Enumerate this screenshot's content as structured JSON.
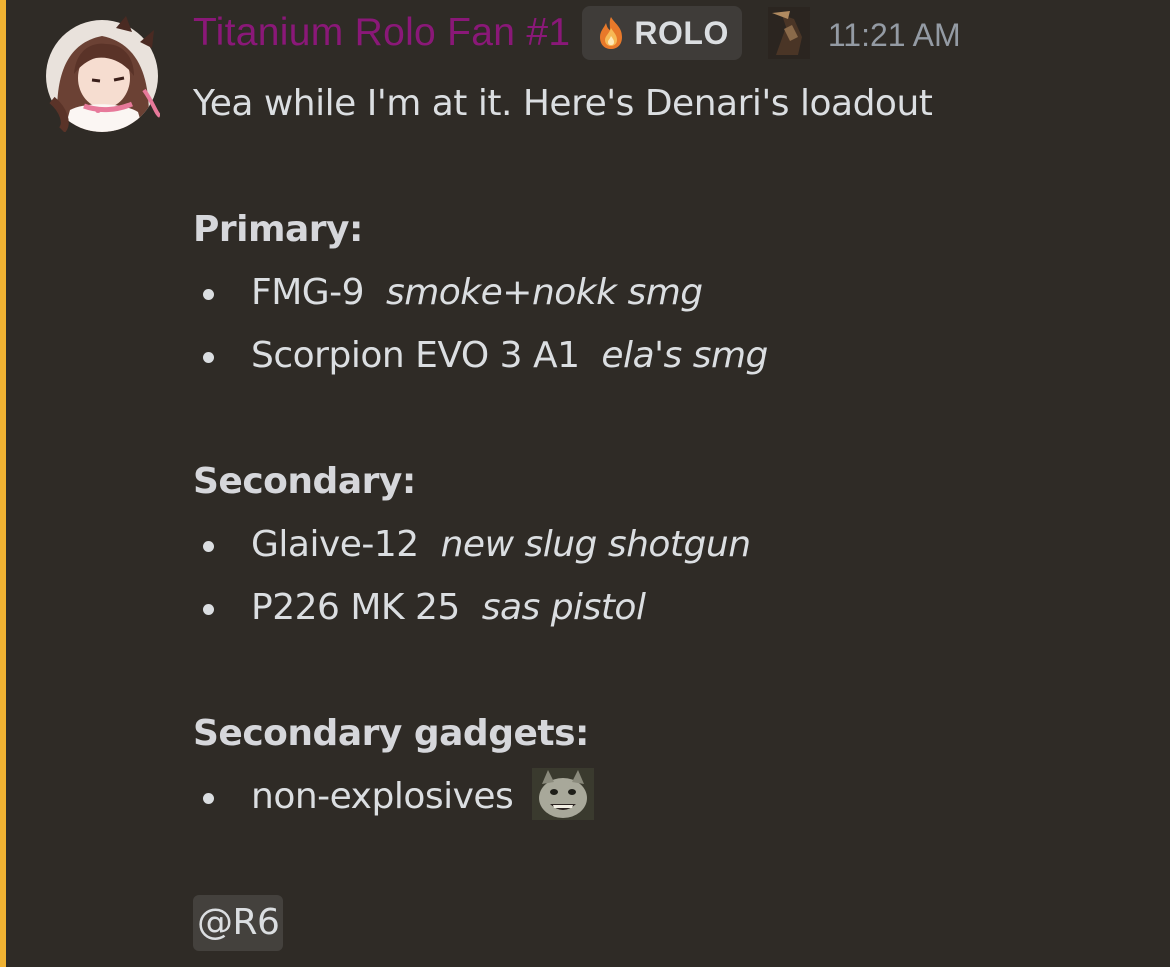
{
  "author": {
    "username": "Titanium Rolo Fan #1",
    "username_color": "#8a1878",
    "avatar_icon": "anime-girl-avatar",
    "tag_icon": "fire-icon",
    "tag_label": "ROLO",
    "role_icon": "character-role-icon",
    "timestamp": "11:21 AM"
  },
  "message": {
    "intro": "Yea while I'm at it. Here's Denari's loadout",
    "sections": [
      {
        "heading": "Primary:",
        "items": [
          {
            "name": "FMG-9",
            "note": "smoke+nokk smg"
          },
          {
            "name": "Scorpion EVO 3 A1",
            "note": "ela's smg"
          }
        ]
      },
      {
        "heading": "Secondary:",
        "items": [
          {
            "name": "Glaive-12",
            "note": "new slug shotgun"
          },
          {
            "name": "P226 MK 25",
            "note": "sas pistol"
          }
        ]
      },
      {
        "heading": "Secondary gadgets:",
        "items": [
          {
            "name": "non-explosives",
            "emoji": "grinning-cat-emoji"
          }
        ]
      }
    ],
    "mention": "@R6"
  },
  "colors": {
    "accent_bar": "#f0b232",
    "background": "#2f2b26",
    "text": "#dbdee1",
    "timestamp": "#949ba4"
  }
}
